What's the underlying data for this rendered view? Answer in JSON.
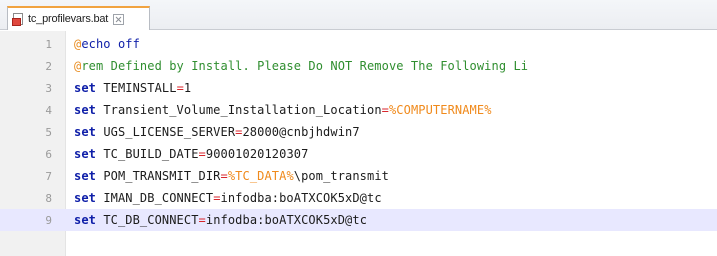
{
  "tab": {
    "filename": "tc_profilevars.bat",
    "close_glyph": "close-icon"
  },
  "colors": {
    "keyword": "#0e1ea8",
    "comment": "#2f8e2f",
    "operator": "#d8262c",
    "variable": "#f08a1c",
    "current_line": "#e8e8ff"
  },
  "lines": [
    {
      "num": "1",
      "at": "@",
      "echo": "echo off"
    },
    {
      "num": "2",
      "at": "@",
      "comment": "rem Defined by Install. Please Do NOT Remove The Following Li"
    },
    {
      "num": "3",
      "kw": "set",
      "name": "TEMINSTALL",
      "eq": "=",
      "value": "1"
    },
    {
      "num": "4",
      "kw": "set",
      "name": "Transient_Volume_Installation_Location",
      "eq": "=",
      "envvar": "%COMPUTERNAME%"
    },
    {
      "num": "5",
      "kw": "set",
      "name": "UGS_LICENSE_SERVER",
      "eq": "=",
      "value": "28000@cnbjhdwin7"
    },
    {
      "num": "6",
      "kw": "set",
      "name": "TC_BUILD_DATE",
      "eq": "=",
      "value": "90001020120307"
    },
    {
      "num": "7",
      "kw": "set",
      "name": "POM_TRANSMIT_DIR",
      "eq": "=",
      "envvar": "%TC_DATA%",
      "value": "\\pom_transmit"
    },
    {
      "num": "8",
      "kw": "set",
      "name": "IMAN_DB_CONNECT",
      "eq": "=",
      "value": "infodba:boATXCOK5xD@tc"
    },
    {
      "num": "9",
      "kw": "set",
      "name": "TC_DB_CONNECT",
      "eq": "=",
      "value": "infodba:boATXCOK5xD@tc"
    }
  ]
}
